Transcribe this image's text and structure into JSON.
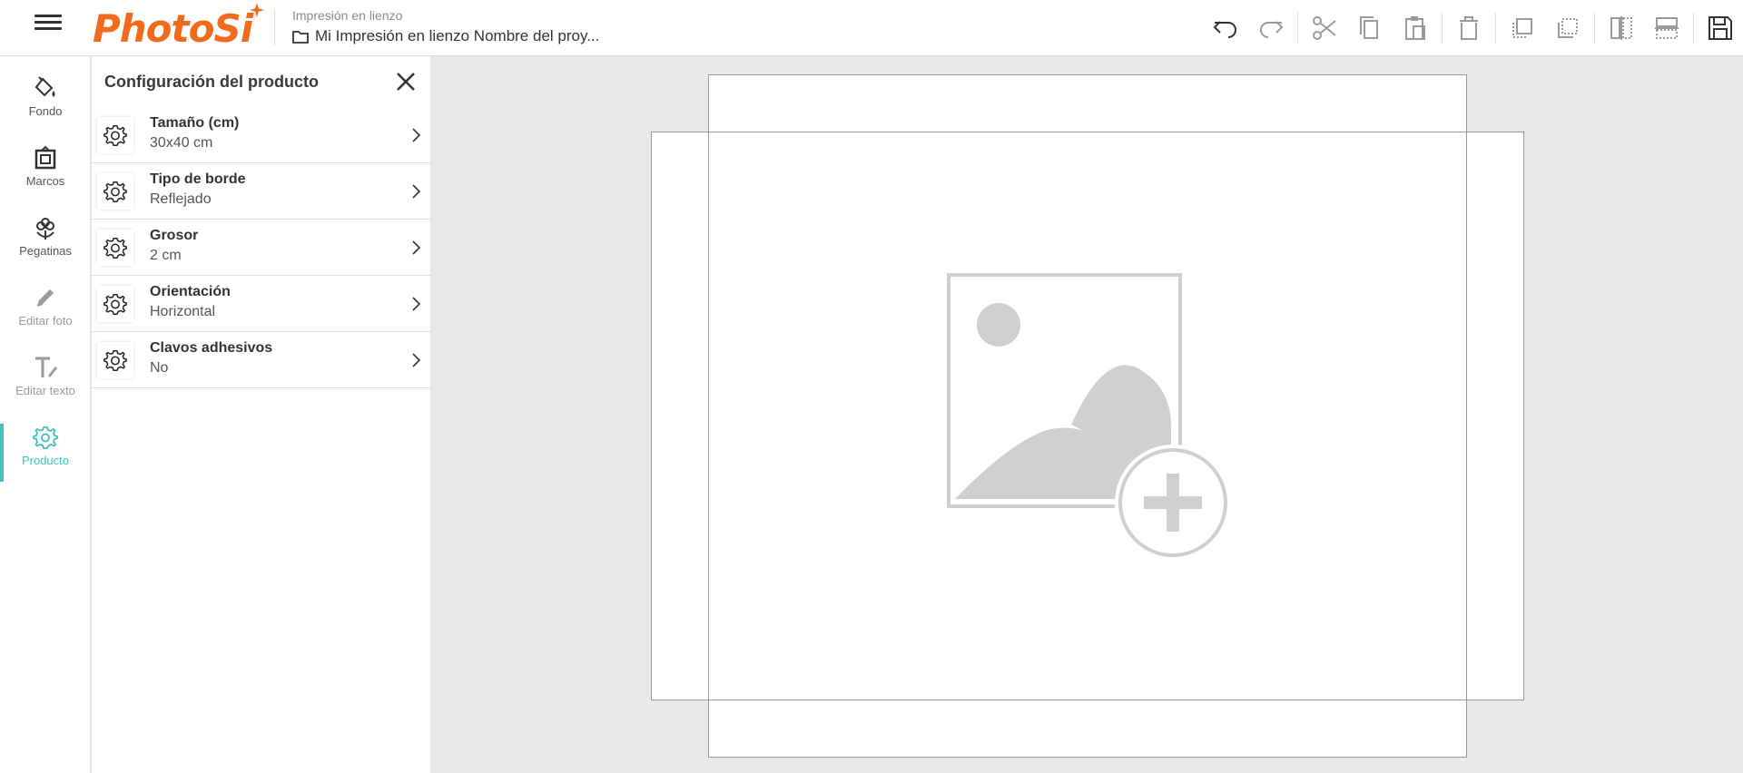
{
  "header": {
    "logo_text": "PhotoSi",
    "product_type": "Impresión en lienzo",
    "project_name": "Mi Impresión en lienzo Nombre del proy..."
  },
  "toolbar": {
    "icons": [
      "undo-icon",
      "redo-icon",
      "cut-icon",
      "copy-icon",
      "paste-icon",
      "delete-icon",
      "bring-forward-icon",
      "send-backward-icon",
      "flip-horizontal-icon",
      "flip-vertical-icon",
      "save-icon"
    ]
  },
  "rail": {
    "items": [
      {
        "label": "Fondo",
        "icon": "paint-bucket-icon"
      },
      {
        "label": "Marcos",
        "icon": "frame-icon"
      },
      {
        "label": "Pegatinas",
        "icon": "sticker-icon"
      },
      {
        "label": "Editar foto",
        "icon": "pencil-icon"
      },
      {
        "label": "Editar texto",
        "icon": "text-icon"
      },
      {
        "label": "Producto",
        "icon": "gear-icon"
      }
    ],
    "active": "Producto"
  },
  "panel": {
    "title": "Configuración del producto",
    "options": [
      {
        "name": "Tamaño (cm)",
        "value": "30x40 cm"
      },
      {
        "name": "Tipo de borde",
        "value": "Reflejado"
      },
      {
        "name": "Grosor",
        "value": "2 cm"
      },
      {
        "name": "Orientación",
        "value": "Horizontal"
      },
      {
        "name": "Clavos adhesivos",
        "value": "No"
      }
    ]
  },
  "colors": {
    "brand": "#f26b1d",
    "accent": "#41c1b8",
    "canvas_bg": "#e9e9e9"
  }
}
